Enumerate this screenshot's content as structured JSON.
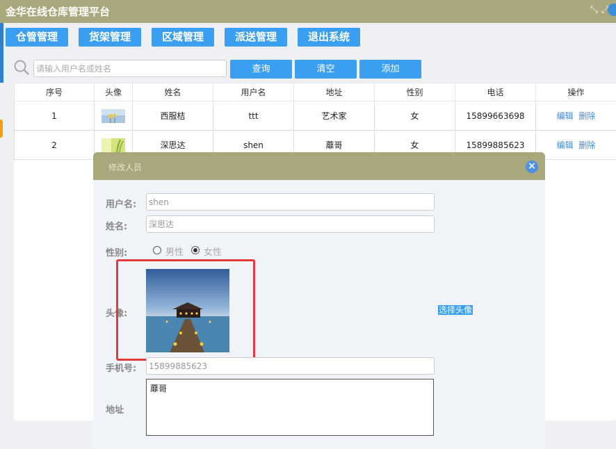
{
  "app": {
    "title": "金华在线仓库管理平台"
  },
  "nav": [
    {
      "label": "仓管管理"
    },
    {
      "label": "货架管理"
    },
    {
      "label": "区域管理"
    },
    {
      "label": "派送管理"
    },
    {
      "label": "退出系统"
    }
  ],
  "search": {
    "placeholder": "请输入用户名或姓名",
    "query_label": "查询",
    "clear_label": "清空",
    "add_label": "添加"
  },
  "table": {
    "headers": [
      "序号",
      "头像",
      "姓名",
      "用户名",
      "地址",
      "性别",
      "电话",
      "操作"
    ],
    "rows": [
      {
        "no": "1",
        "name": "西服桔",
        "username": "ttt",
        "address": "艺术家",
        "gender": "女",
        "phone": "15899663698",
        "edit": "编辑",
        "delete": "删除"
      },
      {
        "no": "2",
        "name": "深思达",
        "username": "shen",
        "address": "蘼哥",
        "gender": "女",
        "phone": "15899885623",
        "edit": "编辑",
        "delete": "删除"
      }
    ]
  },
  "modal": {
    "title": "修改人员",
    "username_label": "用户名:",
    "username_value": "shen",
    "name_label": "姓名:",
    "name_value": "深思达",
    "gender_label": "性别:",
    "gender_male": "男性",
    "gender_female": "女性",
    "gender_selected": "女性",
    "avatar_label": "头像:",
    "choose_avatar": "选择头像",
    "phone_label": "手机号:",
    "phone_value": "15899885623",
    "address_label": "地址",
    "address_value": "蘼哥"
  },
  "colors": {
    "header_bg": "#a9a87c",
    "button_blue": "#3a9ff0",
    "highlight_red": "#e5383b"
  }
}
